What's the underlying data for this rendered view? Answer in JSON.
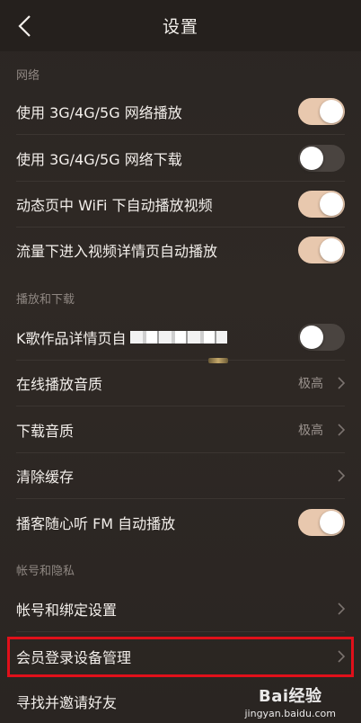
{
  "nav": {
    "title": "设置",
    "back_icon": "chevron-left-icon"
  },
  "sections": {
    "network": "网络",
    "playback": "播放和下载",
    "account": "帐号和隐私"
  },
  "rows": {
    "r1": {
      "label": "使用 3G/4G/5G 网络播放",
      "toggle": "on"
    },
    "r2": {
      "label": "使用 3G/4G/5G 网络下载",
      "toggle": "off"
    },
    "r3": {
      "label": "动态页中 WiFi 下自动播放视频",
      "toggle": "on"
    },
    "r4": {
      "label": "流量下进入视频详情页自动播放",
      "toggle": "on"
    },
    "r5": {
      "label": "K歌作品详情页自",
      "toggle": "off"
    },
    "r6": {
      "label": "在线播放音质",
      "value": "极高"
    },
    "r7": {
      "label": "下载音质",
      "value": "极高"
    },
    "r8": {
      "label": "清除缓存"
    },
    "r9": {
      "label": "播客随心听 FM 自动播放",
      "toggle": "on"
    },
    "r10": {
      "label": "帐号和绑定设置"
    },
    "r11": {
      "label": "会员登录设备管理"
    },
    "r12": {
      "label": "寻找并邀请好友"
    }
  },
  "colors": {
    "toggle_on": "#e8c8ae",
    "toggle_off": "#4a4440",
    "highlight": "#e0101a"
  },
  "watermark": {
    "brand": "Bai经验",
    "url": "jingyan.baidu.com"
  }
}
